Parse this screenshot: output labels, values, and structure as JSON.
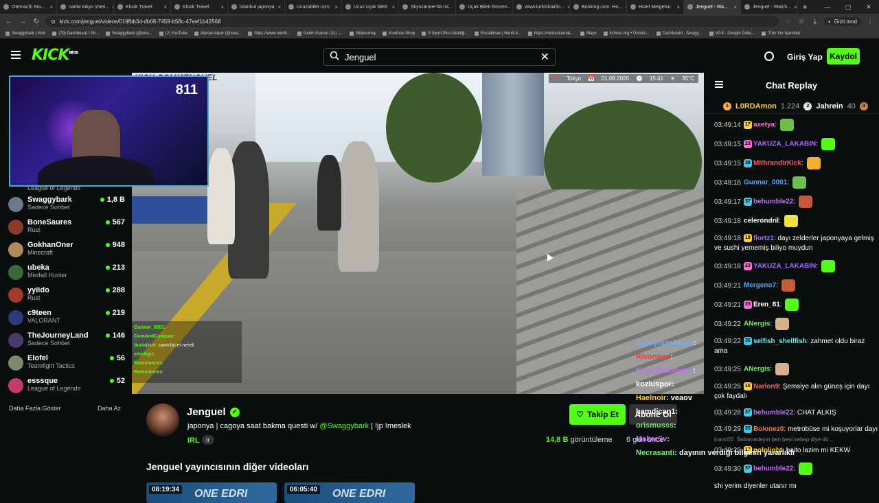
{
  "browser": {
    "tabs": [
      "Otemachi Sta...",
      "narita tokyo sheri...",
      "Klook Travel",
      "Klook Travel",
      "istanbul japonya",
      "Ucuzabilet.com",
      "Ucuz uçak bileti",
      "Skyscanner'da İst...",
      "Uçak Bileti Rezerv...",
      "www.turkishairlin...",
      "Booking.com: Ho...",
      "Hotel Meigetsu",
      "Jenguel - Wa...",
      "Jenguel - Watch..."
    ],
    "url": "kick.com/jenguel/videos/019fbb3d-db08-7459-b58c-47eef1b42568",
    "incognito_label": "Gizli mod",
    "bookmarks": [
      "Swaggybark | Kick",
      "(79) Dashboard / Str...",
      "Swaggybark (@swa...",
      "(2) YouTube",
      "Alpcan Alpar (@swa...",
      "https://www.reddit...",
      "Gelen Kutusu (31) -...",
      "Midjourney",
      "Koefuse Shop",
      "S Sport Plus-İstediğ...",
      "Excalidraw | Hand-d...",
      "https://nextaskarnat...",
      "Maps",
      "lichess.org • Ücretsi...",
      "Dashboard - Swagg...",
      "V0.8 - Google Doku...",
      "Tüm Yer İşaretleri"
    ]
  },
  "header": {
    "logo": "KICK",
    "logo_badge": "BETA",
    "search_value": "Jenguel",
    "login": "Giriş Yap",
    "signup": "Kaydol"
  },
  "sidebar": {
    "webcam_viewers": "811",
    "first_game": "League of Legends",
    "channels": [
      {
        "name": "Swaggybark",
        "game": "Sadece Sohbet",
        "viewers": "1,8 B",
        "color": "#6b7b8c"
      },
      {
        "name": "BoneSaures",
        "game": "Rust",
        "viewers": "567",
        "color": "#8a3b2a"
      },
      {
        "name": "GokhanOner",
        "game": "Minecraft",
        "viewers": "948",
        "color": "#b08a5a"
      },
      {
        "name": "ubeka",
        "game": "Mistfall Hunter",
        "viewers": "213",
        "color": "#3a6a3a"
      },
      {
        "name": "yyiido",
        "game": "Rust",
        "viewers": "288",
        "color": "#a33a2a"
      },
      {
        "name": "c9teen",
        "game": "VALORANT",
        "viewers": "219",
        "color": "#2a3a7a"
      },
      {
        "name": "TheJourneyLand",
        "game": "Sadece Sohbet",
        "viewers": "146",
        "color": "#4a3a6a"
      },
      {
        "name": "Elofel",
        "game": "Teamfight Tactics",
        "viewers": "56",
        "color": "#7a8a6a"
      },
      {
        "name": "esssque",
        "game": "League of Legends",
        "viewers": "52",
        "color": "#c43a6a"
      }
    ],
    "show_more": "Daha Fazla Göster",
    "show_less": "Daha Az"
  },
  "video": {
    "watermark": "KICK.COM/JENGUEL",
    "location": "Tokyo",
    "date": "01.08.2026",
    "time": "15:41",
    "temp": "35°C",
    "overlay_chat": [
      {
        "user": "Gunnar_0001",
        "text": ""
      },
      {
        "user": "ComAndConquer",
        "text": ""
      },
      {
        "user": "buraqkun",
        "text": "cano bu et nereli"
      },
      {
        "user": "emirhgn",
        "text": ""
      },
      {
        "user": "Ramolances",
        "text": ""
      },
      {
        "user": "Ramolances",
        "text": ""
      }
    ]
  },
  "channel": {
    "name": "Jenguel",
    "title_prefix": "japonya | cagoya saat bakma questi w/",
    "title_mention": "@Swaggybark",
    "title_suffix": "| !jp !meslek",
    "category": "IRL",
    "language": "tr",
    "follow": "Takip Et",
    "subscribe": "Abone Ol",
    "views_num": "14,8 B",
    "views_label": "görüntüleme",
    "ago": "6 gün önce",
    "other_videos": "Jenguel yayıncısının diğer videoları",
    "thumbs": [
      {
        "dur": "08:19:34",
        "label": "ONE EDRI"
      },
      {
        "dur": "06:05:40",
        "label": "ONE EDRI"
      }
    ]
  },
  "chat": {
    "title": "Chat Replay",
    "pinned": [
      {
        "rank": "1",
        "name": "L0RDAmon",
        "score": "1.224"
      },
      {
        "rank": "2",
        "name": "Jahrein",
        "score": "40"
      }
    ],
    "messages": [
      {
        "time": "03:49:14",
        "badge": "17",
        "bc": "#f7d13a",
        "user": "axetya",
        "uc": "#ff6bd6",
        "text": "",
        "emote": "#6cc04a"
      },
      {
        "time": "03:49:15",
        "badge": "23",
        "bc": "#ff6bd6",
        "user": "YAKUZA_LAKABIN",
        "uc": "#a56bff",
        "text": "",
        "emote": "#53fc18"
      },
      {
        "time": "03:49:15",
        "badge": "38",
        "bc": "#4ec3e0",
        "user": "MithrandirKick",
        "uc": "#ff5a5a",
        "text": "",
        "emote": "#f0b030"
      },
      {
        "time": "03:49:16",
        "badge": "",
        "bc": "",
        "user": "Gunnar_0001",
        "uc": "#4ea7ff",
        "text": "",
        "emote": "#6cc04a"
      },
      {
        "time": "03:49:17",
        "badge": "37",
        "bc": "#4ec3e0",
        "user": "behumble22",
        "uc": "#c56bff",
        "text": "",
        "emote": "#c45a3a"
      },
      {
        "time": "03:49:18",
        "badge": "",
        "bc": "",
        "user": "celerondril",
        "uc": "#ffffff",
        "text": "",
        "emote": "#f0e040"
      },
      {
        "time": "03:49:18",
        "badge": "18",
        "bc": "#f7d13a",
        "user": "flortz1",
        "uc": "#a56bff",
        "text": "dayı zelderler japonyaya gelmiş ve sushi yememiş biliyo muydun",
        "emote": ""
      },
      {
        "time": "03:49:18",
        "badge": "23",
        "bc": "#ff6bd6",
        "user": "YAKUZA_LAKABIN",
        "uc": "#a56bff",
        "text": "",
        "emote": "#53fc18"
      },
      {
        "time": "03:49:21",
        "badge": "",
        "bc": "",
        "user": "Mergeno7",
        "uc": "#4ea7ff",
        "text": "",
        "emote": "#c45a3a"
      },
      {
        "time": "03:49:21",
        "badge": "23",
        "bc": "#ff6bd6",
        "user": "Eren_81",
        "uc": "#ffffff",
        "text": "",
        "emote": "#53fc18"
      },
      {
        "time": "03:49:22",
        "badge": "",
        "bc": "",
        "user": "ANergis",
        "uc": "#6cf06c",
        "text": "",
        "emote": "#d6b08a"
      },
      {
        "time": "03:49:22",
        "badge": "35",
        "bc": "#4ec3e0",
        "user": "selfish_shellfish",
        "uc": "#6cf0f0",
        "text": "zahmet oldu biraz ama",
        "emote": ""
      },
      {
        "time": "03:49:25",
        "badge": "",
        "bc": "",
        "user": "ANergis",
        "uc": "#6cf06c",
        "text": "",
        "emote": "#d6b08a"
      },
      {
        "time": "03:49:26",
        "badge": "15",
        "bc": "#f7d13a",
        "user": "Narlon9",
        "uc": "#ff5a5a",
        "text": "Şemsiye alın güneş için dayı çok faydalı",
        "emote": ""
      },
      {
        "time": "03:49:28",
        "badge": "37",
        "bc": "#4ec3e0",
        "user": "behumble22",
        "uc": "#c56bff",
        "text": "CHAT ALKIŞ",
        "emote": ""
      },
      {
        "time": "03:49:29",
        "badge": "35",
        "bc": "#4ec3e0",
        "user": "Bolonez0",
        "uc": "#ff7a3a",
        "text": "metrobüse mi koşuyorlar dayı",
        "emote": ""
      },
      {
        "time": "03:49:29",
        "badge": "17",
        "bc": "#f7d13a",
        "user": "pololight",
        "uc": "#f7d13a",
        "text": "baito lazim mi KEKW",
        "emote": ""
      },
      {
        "time": "03:49:30",
        "badge": "37",
        "bc": "#4ec3e0",
        "user": "behumble22",
        "uc": "#c56bff",
        "text": "",
        "emote": "#53fc18"
      }
    ],
    "reply_hint": "inanc02: Saitamadayın ben best kebap diye dü...",
    "last_partial": "shi yerim diyenler utanır mı"
  },
  "floating_chat": [
    {
      "user": "huseyinpskingp",
      "color": "#7aa8ff",
      "text": ""
    },
    {
      "user": "Rivonimo",
      "color": "#ff3a3a",
      "text": ""
    },
    {
      "user": "KnockedDownn",
      "color": "#c56bff",
      "text": ""
    },
    {
      "user": "kozluspor",
      "color": "#ffffff",
      "text": ""
    },
    {
      "user": "Haelnoir",
      "color": "#ffc83a",
      "text": "veaov"
    },
    {
      "user": "hamdican1",
      "color": "#ffffff",
      "text": ""
    },
    {
      "user": "orismusss",
      "color": "#6cf06c",
      "text": ""
    },
    {
      "user": "MakerSv",
      "color": "#c56bff",
      "text": ""
    },
    {
      "user": "Necrasanti",
      "color": "#6cf06c",
      "text": "dayının verdiği bilginin yararlıklı"
    }
  ]
}
